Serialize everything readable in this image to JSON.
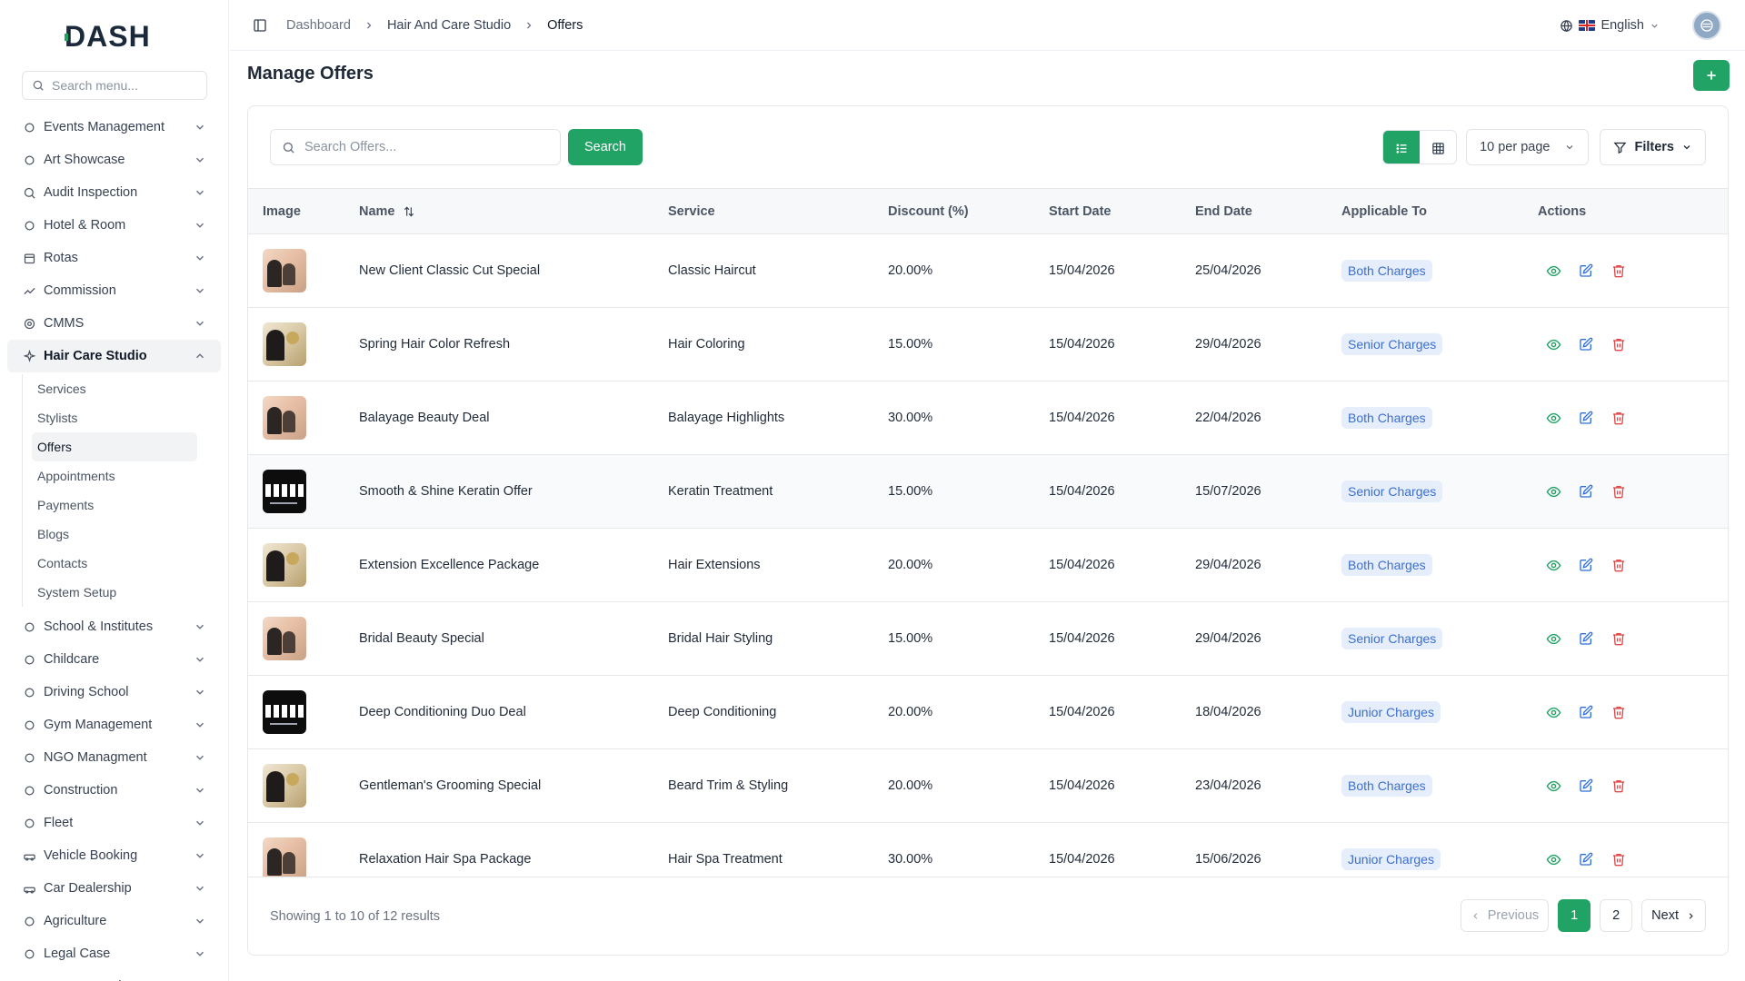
{
  "brand": {
    "logo_text": "DASH"
  },
  "sidebar": {
    "search_placeholder": "Search menu...",
    "items_top": [
      {
        "label": "Events Management",
        "icon": "events-icon"
      },
      {
        "label": "Art Showcase",
        "icon": "palette-icon"
      },
      {
        "label": "Audit Inspection",
        "icon": "search-icon"
      },
      {
        "label": "Hotel & Room",
        "icon": "hotel-icon"
      },
      {
        "label": "Rotas",
        "icon": "calendar-icon"
      },
      {
        "label": "Commission",
        "icon": "trend-icon"
      },
      {
        "label": "CMMS",
        "icon": "gear-icon"
      }
    ],
    "active_group": {
      "label": "Hair Care Studio",
      "icon": "sparkle-icon"
    },
    "sub_items": [
      "Services",
      "Stylists",
      "Offers",
      "Appointments",
      "Payments",
      "Blogs",
      "Contacts",
      "System Setup"
    ],
    "active_sub": "Offers",
    "items_bottom": [
      {
        "label": "School & Institutes",
        "icon": "school-icon"
      },
      {
        "label": "Childcare",
        "icon": "child-icon"
      },
      {
        "label": "Driving School",
        "icon": "wheel-icon"
      },
      {
        "label": "Gym Management",
        "icon": "dumbbell-icon"
      },
      {
        "label": "NGO Managment",
        "icon": "heart-hands-icon"
      },
      {
        "label": "Construction",
        "icon": "crane-icon"
      },
      {
        "label": "Fleet",
        "icon": "bus-icon"
      },
      {
        "label": "Vehicle Booking",
        "icon": "car-icon"
      },
      {
        "label": "Car Dealership",
        "icon": "car-front-icon"
      },
      {
        "label": "Agriculture",
        "icon": "tractor-icon"
      },
      {
        "label": "Legal Case",
        "icon": "scale-icon"
      },
      {
        "label": "Tour & Travel",
        "icon": "plane-icon"
      }
    ]
  },
  "topbar": {
    "breadcrumbs": [
      "Dashboard",
      "Hair And Care Studio",
      "Offers"
    ],
    "language": "English"
  },
  "page": {
    "title": "Manage Offers",
    "add_icon": "plus-icon"
  },
  "toolbar": {
    "search_placeholder": "Search Offers...",
    "search_button": "Search",
    "per_page": "10 per page",
    "filters": "Filters"
  },
  "table": {
    "columns": [
      "Image",
      "Name",
      "Service",
      "Discount (%)",
      "Start Date",
      "End Date",
      "Applicable To",
      "Actions"
    ],
    "rows": [
      {
        "image": "photo",
        "name": "New Client Classic Cut Special",
        "service": "Classic Haircut",
        "discount": "20.00%",
        "start": "15/04/2026",
        "end": "25/04/2026",
        "applicable": "Both Charges"
      },
      {
        "image": "photo2",
        "name": "Spring Hair Color Refresh",
        "service": "Hair Coloring",
        "discount": "15.00%",
        "start": "15/04/2026",
        "end": "29/04/2026",
        "applicable": "Senior Charges"
      },
      {
        "image": "photo",
        "name": "Balayage Beauty Deal",
        "service": "Balayage Highlights",
        "discount": "30.00%",
        "start": "15/04/2026",
        "end": "22/04/2026",
        "applicable": "Both Charges"
      },
      {
        "image": "sale",
        "name": "Smooth & Shine Keratin Offer",
        "service": "Keratin Treatment",
        "discount": "15.00%",
        "start": "15/04/2026",
        "end": "15/07/2026",
        "applicable": "Senior Charges"
      },
      {
        "image": "photo2",
        "name": "Extension Excellence Package",
        "service": "Hair Extensions",
        "discount": "20.00%",
        "start": "15/04/2026",
        "end": "29/04/2026",
        "applicable": "Both Charges"
      },
      {
        "image": "photo",
        "name": "Bridal Beauty Special",
        "service": "Bridal Hair Styling",
        "discount": "15.00%",
        "start": "15/04/2026",
        "end": "29/04/2026",
        "applicable": "Senior Charges"
      },
      {
        "image": "sale",
        "name": "Deep Conditioning Duo Deal",
        "service": "Deep Conditioning",
        "discount": "20.00%",
        "start": "15/04/2026",
        "end": "18/04/2026",
        "applicable": "Junior Charges"
      },
      {
        "image": "photo2",
        "name": "Gentleman's Grooming Special",
        "service": "Beard Trim & Styling",
        "discount": "20.00%",
        "start": "15/04/2026",
        "end": "23/04/2026",
        "applicable": "Both Charges"
      },
      {
        "image": "photo",
        "name": "Relaxation Hair Spa Package",
        "service": "Hair Spa Treatment",
        "discount": "30.00%",
        "start": "15/04/2026",
        "end": "15/06/2026",
        "applicable": "Junior Charges"
      }
    ]
  },
  "footer": {
    "showing": "Showing 1 to 10 of 12 results",
    "prev": "Previous",
    "pages": [
      "1",
      "2"
    ],
    "next": "Next"
  },
  "colors": {
    "accent": "#21a366",
    "badge_bg": "#e6eefb",
    "badge_text": "#3b6fcf",
    "view_icon": "#21a366",
    "delete_icon": "#e04848",
    "edit_icon": "#2f6fdc"
  }
}
